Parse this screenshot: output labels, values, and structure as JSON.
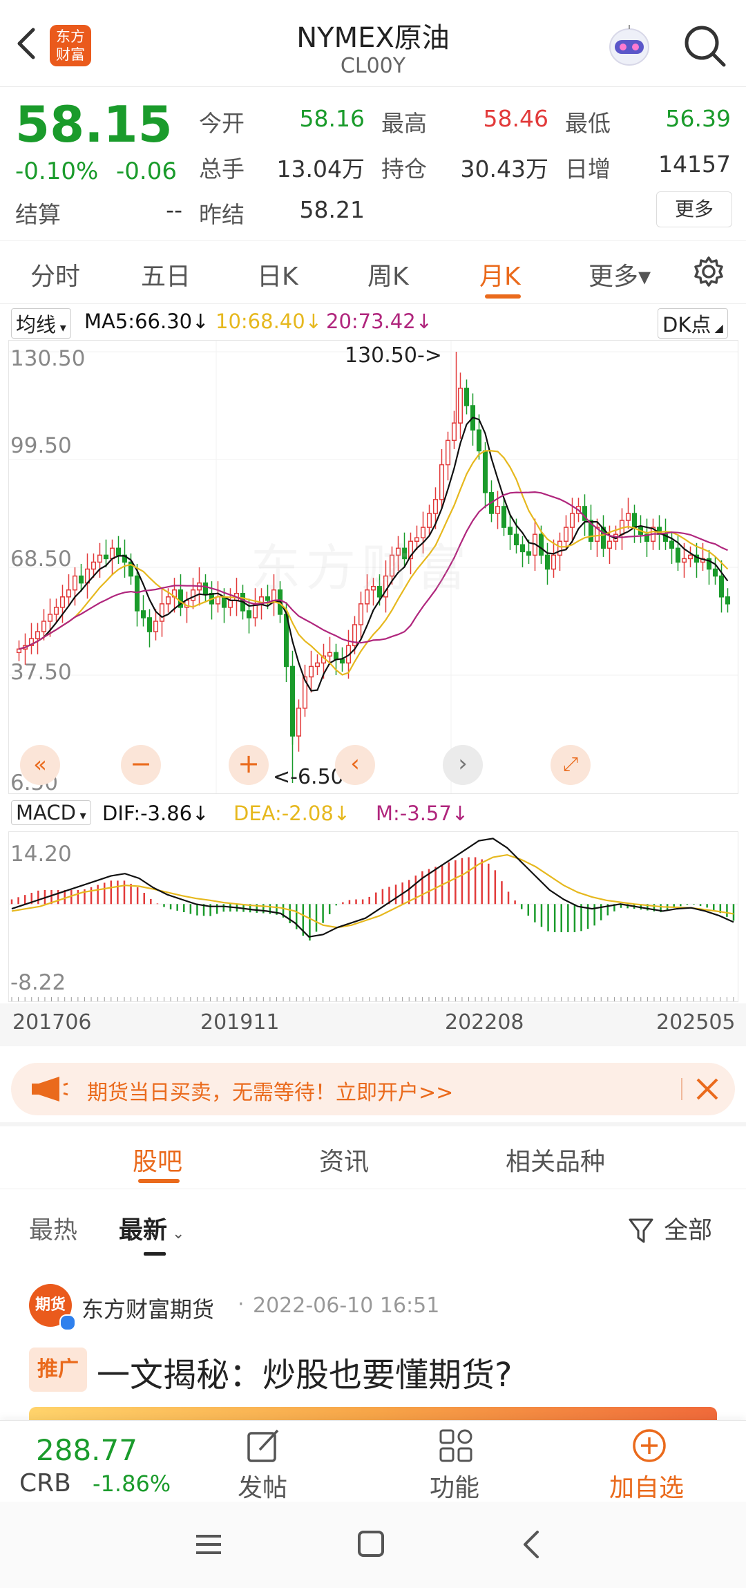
{
  "header": {
    "title": "NYMEX原油",
    "subtitle": "CL00Y",
    "logo_text_line1": "东方",
    "logo_text_line2": "财富"
  },
  "quote": {
    "last": "58.15",
    "change_pct": "-0.10%",
    "change": "-0.06",
    "settle_label": "结算",
    "settle_value": "--",
    "open_label": "今开",
    "open_value": "58.16",
    "high_label": "最高",
    "high_value": "58.46",
    "low_label": "最低",
    "low_value": "56.39",
    "volume_label": "总手",
    "volume_value": "13.04万",
    "oi_label": "持仓",
    "oi_value": "30.43万",
    "daily_inc_label": "日增",
    "daily_inc_value": "14157",
    "prev_settle_label": "昨结",
    "prev_settle_value": "58.21",
    "more_label": "更多"
  },
  "period_tabs": [
    "分时",
    "五日",
    "日K",
    "周K",
    "月K",
    "更多▾"
  ],
  "active_period": "月K",
  "ma_legend": {
    "selector": "均线",
    "ma5": "MA5:66.30↓",
    "ma10": "10:68.40↓",
    "ma20": "20:73.42↓",
    "dk_label": "DK点"
  },
  "macd_legend": {
    "selector": "MACD",
    "dif": "DIF:-3.86↓",
    "dea": "DEA:-2.08↓",
    "m": "M:-3.57↓"
  },
  "colors": {
    "accent": "#ea6a1c",
    "up": "#e23a3a",
    "down": "#1a9b2b",
    "ma5": "#111111",
    "ma10": "#e6b81e",
    "ma20": "#b0267d"
  },
  "chart_data": [
    {
      "type": "candlestick",
      "title": "",
      "y_ticks": [
        "130.50",
        "99.50",
        "68.50",
        "37.50",
        "6.50"
      ],
      "ylim": [
        6.5,
        130.5
      ],
      "annotations": [
        "130.50->",
        "<-6.50"
      ],
      "x_ticks": [
        "201706",
        "201911",
        "202208",
        "202505"
      ],
      "series": [
        {
          "name": "MA5",
          "value": 66.3
        },
        {
          "name": "10",
          "value": 68.4
        },
        {
          "name": "20",
          "value": 73.42
        }
      ],
      "close_approx": [
        45,
        46,
        48,
        50,
        53,
        55,
        57,
        60,
        62,
        66,
        64,
        68,
        70,
        72,
        71,
        74,
        72,
        70,
        66,
        56,
        54,
        50,
        53,
        58,
        60,
        62,
        57,
        59,
        62,
        64,
        61,
        58,
        60,
        57,
        59,
        61,
        56,
        54,
        58,
        60,
        59,
        62,
        55,
        40,
        20,
        28,
        37,
        40,
        41,
        43,
        44,
        42,
        41,
        46,
        52,
        58,
        62,
        63,
        60,
        66,
        72,
        74,
        71,
        76,
        77,
        80,
        84,
        88,
        98,
        105,
        110,
        120,
        115,
        108,
        102,
        90,
        84,
        86,
        80,
        78,
        75,
        73,
        72,
        78,
        72,
        68,
        72,
        76,
        80,
        84,
        86,
        82,
        76,
        80,
        74,
        76,
        78,
        82,
        84,
        80,
        78,
        76,
        80,
        78,
        76,
        74,
        70,
        71,
        72,
        70,
        71,
        68,
        66,
        60,
        58
      ]
    },
    {
      "type": "macd",
      "y_ticks": [
        "14.20",
        "-8.22"
      ],
      "ylim": [
        -8.22,
        14.2
      ],
      "x_ticks": [
        "201706",
        "201911",
        "202208",
        "202505"
      ],
      "series": [
        {
          "name": "DIF",
          "value": -3.86
        },
        {
          "name": "DEA",
          "value": -2.08
        },
        {
          "name": "M",
          "value": -3.57
        }
      ],
      "dif_approx": [
        -1.0,
        0.0,
        1.0,
        2.0,
        3.0,
        4.0,
        5.0,
        6.0,
        6.5,
        5.5,
        3.5,
        2.0,
        1.0,
        0.0,
        -0.5,
        -0.5,
        -0.8,
        -1.2,
        -1.5,
        -2.0,
        -4.0,
        -7.0,
        -6.5,
        -5.0,
        -4.0,
        -3.0,
        -1.0,
        1.0,
        3.0,
        5.5,
        7.5,
        9.5,
        11.5,
        13.5,
        14.0,
        12.0,
        9.0,
        6.0,
        3.0,
        1.0,
        -0.5,
        -1.0,
        -0.5,
        0.0,
        -0.5,
        -1.0,
        -1.5,
        -1.0,
        -0.8,
        -1.5,
        -2.5,
        -3.86
      ],
      "dea_approx": [
        -1.5,
        -1.0,
        -0.5,
        0.5,
        1.5,
        2.5,
        3.0,
        3.5,
        4.0,
        3.8,
        3.2,
        2.5,
        1.8,
        1.2,
        0.8,
        0.3,
        0.0,
        -0.3,
        -0.5,
        -0.8,
        -1.5,
        -3.0,
        -4.5,
        -5.0,
        -4.5,
        -3.5,
        -2.5,
        -1.0,
        0.5,
        2.0,
        3.5,
        5.0,
        6.5,
        8.5,
        10.0,
        10.5,
        9.5,
        8.0,
        6.0,
        4.0,
        2.5,
        1.5,
        0.8,
        0.4,
        0.0,
        -0.3,
        -0.6,
        -0.7,
        -0.8,
        -1.2,
        -1.6,
        -2.08
      ]
    }
  ],
  "banner": {
    "text": "期货当日买卖，无需等待！立即开户>>"
  },
  "content_tabs": [
    "股吧",
    "资讯",
    "相关品种"
  ],
  "active_content_tab": "股吧",
  "sort": {
    "hot": "最热",
    "latest": "最新",
    "filter": "全部"
  },
  "post": {
    "author": "东方财富期货",
    "time": "2022-06-10 16:51",
    "avatar_text": "期货",
    "tag": "推广",
    "title": "一文揭秘：炒股也要懂期货?"
  },
  "bottom_bar": {
    "index_value": "288.77",
    "index_name": "CRB",
    "index_change": "-1.86%",
    "post_label": "发帖",
    "func_label": "功能",
    "add_label": "加自选"
  }
}
